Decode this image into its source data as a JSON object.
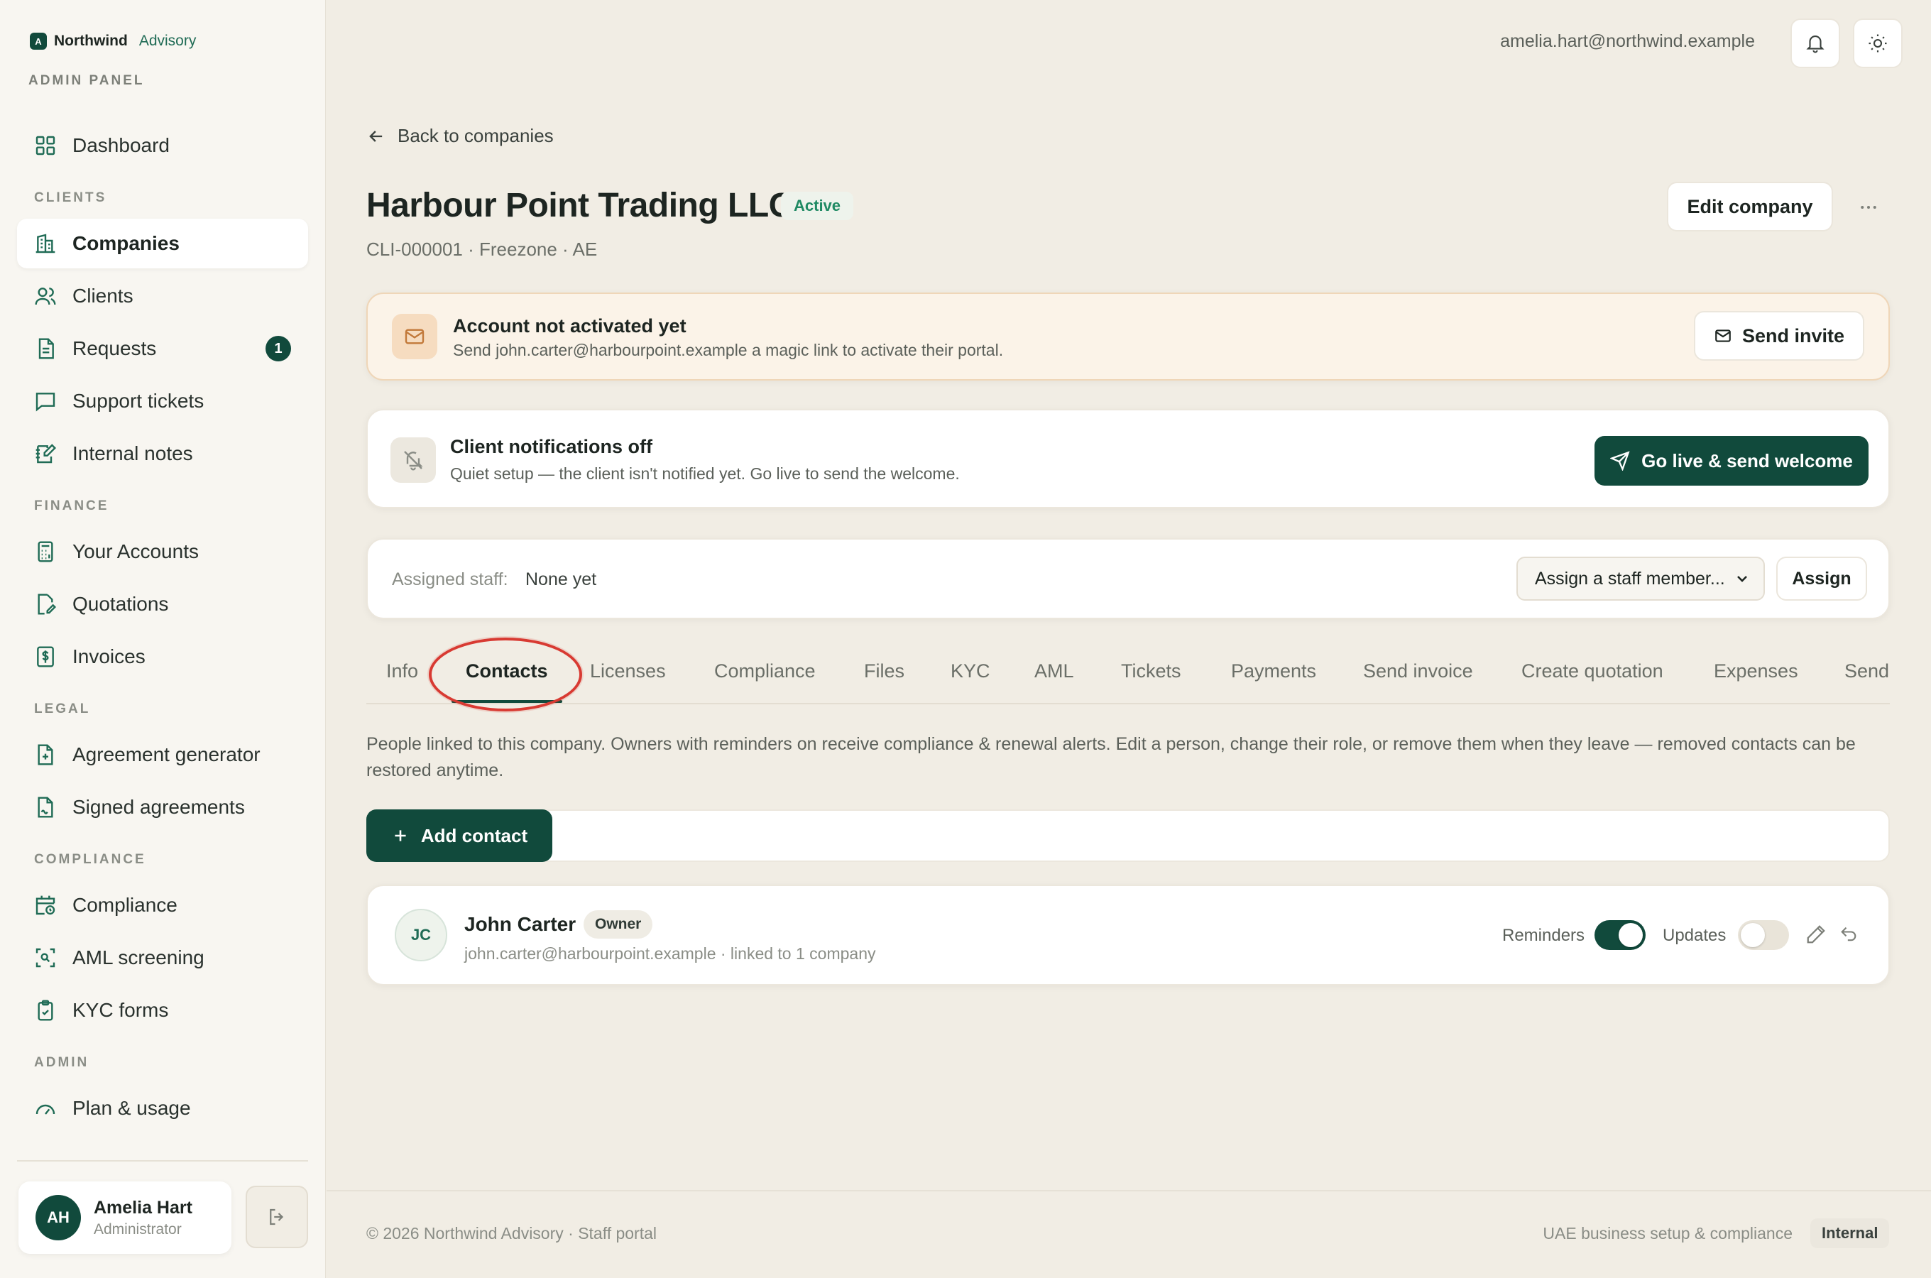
{
  "brand": {
    "logo_letter": "A",
    "name": "Northwind",
    "sub": "Advisory",
    "panel_label": "ADMIN PANEL"
  },
  "sidebar": {
    "dashboard": "Dashboard",
    "sections": {
      "clients": "CLIENTS",
      "finance": "FINANCE",
      "legal": "LEGAL",
      "compliance": "COMPLIANCE",
      "admin": "ADMIN"
    },
    "items": {
      "companies": "Companies",
      "clients": "Clients",
      "requests": "Requests",
      "requests_badge": "1",
      "support": "Support tickets",
      "notes": "Internal notes",
      "accounts": "Your Accounts",
      "quotations": "Quotations",
      "invoices": "Invoices",
      "agreement_gen": "Agreement generator",
      "signed": "Signed agreements",
      "compliance": "Compliance",
      "aml": "AML screening",
      "kyc": "KYC forms",
      "plan": "Plan & usage"
    },
    "user": {
      "initials": "AH",
      "name": "Amelia Hart",
      "role": "Administrator"
    }
  },
  "header": {
    "email": "amelia.hart@northwind.example"
  },
  "page": {
    "back": "Back to companies",
    "title": "Harbour Point Trading LLC",
    "status": "Active",
    "subtitle": "CLI-000001 · Freezone · AE",
    "edit": "Edit company"
  },
  "activation": {
    "title": "Account not activated yet",
    "desc": "Send john.carter@harbourpoint.example a magic link to activate their portal.",
    "button": "Send invite"
  },
  "notifications": {
    "title": "Client notifications off",
    "desc": "Quiet setup — the client isn't notified yet. Go live to send the welcome.",
    "button": "Go live & send welcome"
  },
  "staff": {
    "label": "Assigned staff:",
    "value": "None yet",
    "select": "Assign a staff member...",
    "assign": "Assign"
  },
  "tabs": [
    "Info",
    "Contacts",
    "Licenses",
    "Compliance",
    "Files",
    "KYC",
    "AML",
    "Tickets",
    "Payments",
    "Send invoice",
    "Create quotation",
    "Expenses",
    "Send"
  ],
  "contacts": {
    "intro": "People linked to this company. Owners with reminders on receive compliance & renewal alerts. Edit a person, change their role, or remove them when they leave — removed contacts can be restored anytime.",
    "add": "Add contact",
    "list": [
      {
        "initials": "JC",
        "name": "John Carter",
        "role": "Owner",
        "meta": "john.carter@harbourpoint.example · linked to 1 company",
        "reminders_label": "Reminders",
        "updates_label": "Updates"
      }
    ]
  },
  "footer": {
    "left": "© 2026 Northwind Advisory · Staff portal",
    "right": "UAE business setup & compliance",
    "badge": "Internal"
  },
  "colors": {
    "accent": "#114a3c",
    "active_green": "#1f8a63",
    "annotation": "#d83a32"
  }
}
